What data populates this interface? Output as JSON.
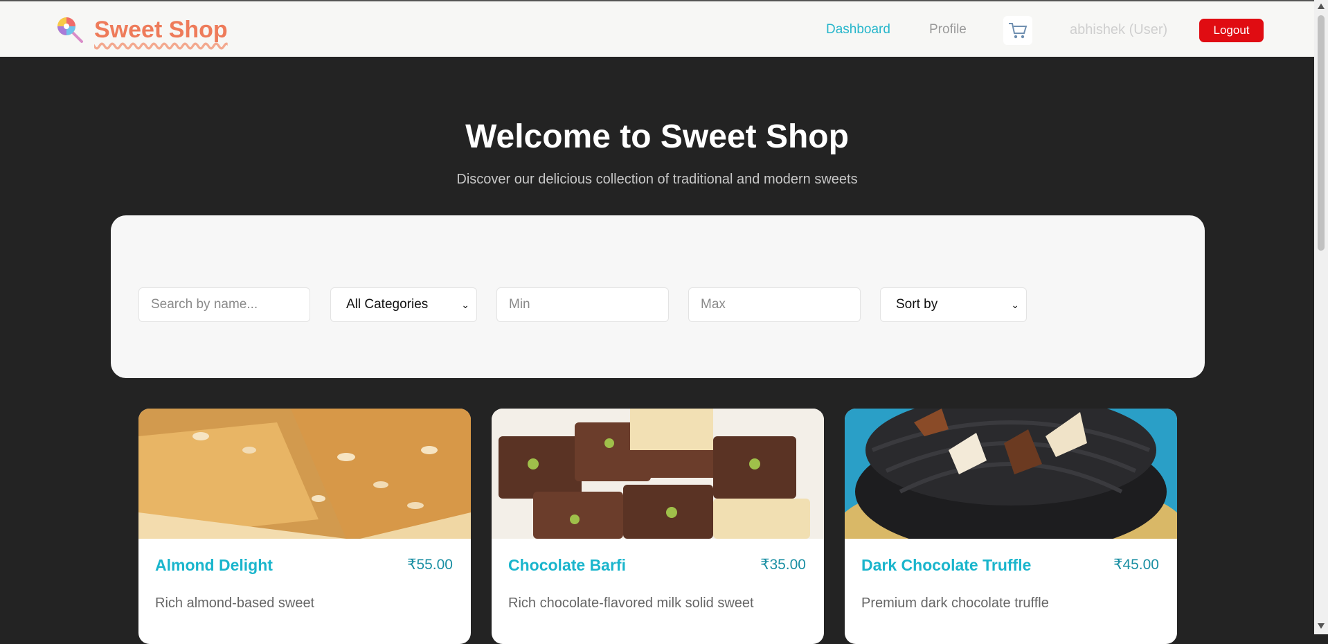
{
  "header": {
    "brand": "Sweet Shop",
    "nav": {
      "dashboard": "Dashboard",
      "profile": "Profile"
    },
    "cart_icon": "cart-icon",
    "user": "abhishek (User)",
    "logout": "Logout"
  },
  "hero": {
    "title": "Welcome to Sweet Shop",
    "subtitle": "Discover our delicious collection of traditional and modern sweets"
  },
  "filters": {
    "search_placeholder": "Search by name...",
    "category_selected": "All Categories",
    "min_placeholder": "Min",
    "max_placeholder": "Max",
    "sort_selected": "Sort by"
  },
  "products": [
    {
      "name": "Almond Delight",
      "price": "₹55.00",
      "description": "Rich almond-based sweet"
    },
    {
      "name": "Chocolate Barfi",
      "price": "₹35.00",
      "description": "Rich chocolate-flavored milk solid sweet"
    },
    {
      "name": "Dark Chocolate Truffle",
      "price": "₹45.00",
      "description": "Premium dark chocolate truffle"
    }
  ],
  "colors": {
    "accent": "#27b6cb",
    "brand": "#ee7b5a",
    "logout": "#e00c12",
    "background": "#232323"
  }
}
